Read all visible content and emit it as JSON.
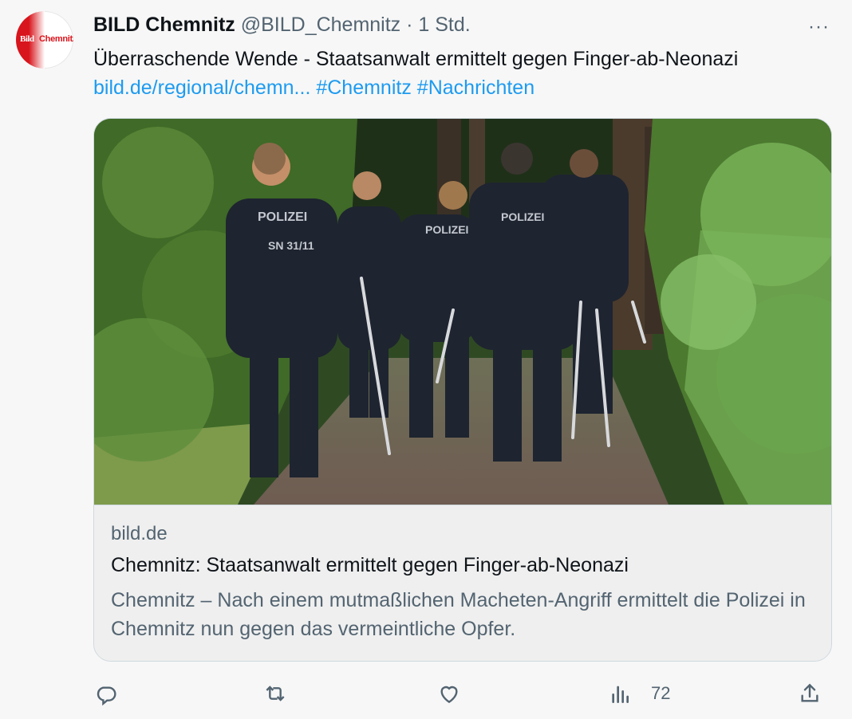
{
  "author": {
    "name": "BILD Chemnitz",
    "handle": "@BILD_Chemnitz",
    "time": "· 1 Std.",
    "avatar_bild": "Bild",
    "avatar_chemnitz": "Chemnitz"
  },
  "more_label": "···",
  "tweet": {
    "text": "Überraschende Wende - Staatsanwalt ermittelt gegen Finger-ab-Neonazi",
    "link": "bild.de/regional/chemn...",
    "hashtag1": "#Chemnitz",
    "hashtag2": "#Nachrichten"
  },
  "card": {
    "domain": "bild.de",
    "title": "Chemnitz: Staatsanwalt ermittelt gegen Finger-ab-Neonazi",
    "description": "Chemnitz – Nach einem mutmaßlichen Macheten-Angriff ermittelt die Polizei in Chemnitz nun gegen das vermeintliche Opfer.",
    "media_vest_text": "POLIZEI",
    "media_vest_number": "SN 31/11"
  },
  "actions": {
    "reply_icon": "reply-icon",
    "retweet_icon": "retweet-icon",
    "like_icon": "heart-icon",
    "views_icon": "views-icon",
    "views_count": "72",
    "share_icon": "share-icon"
  },
  "colors": {
    "accent": "#1d9bf0",
    "secondary_text": "#536471",
    "brand_red": "#d8141c"
  }
}
